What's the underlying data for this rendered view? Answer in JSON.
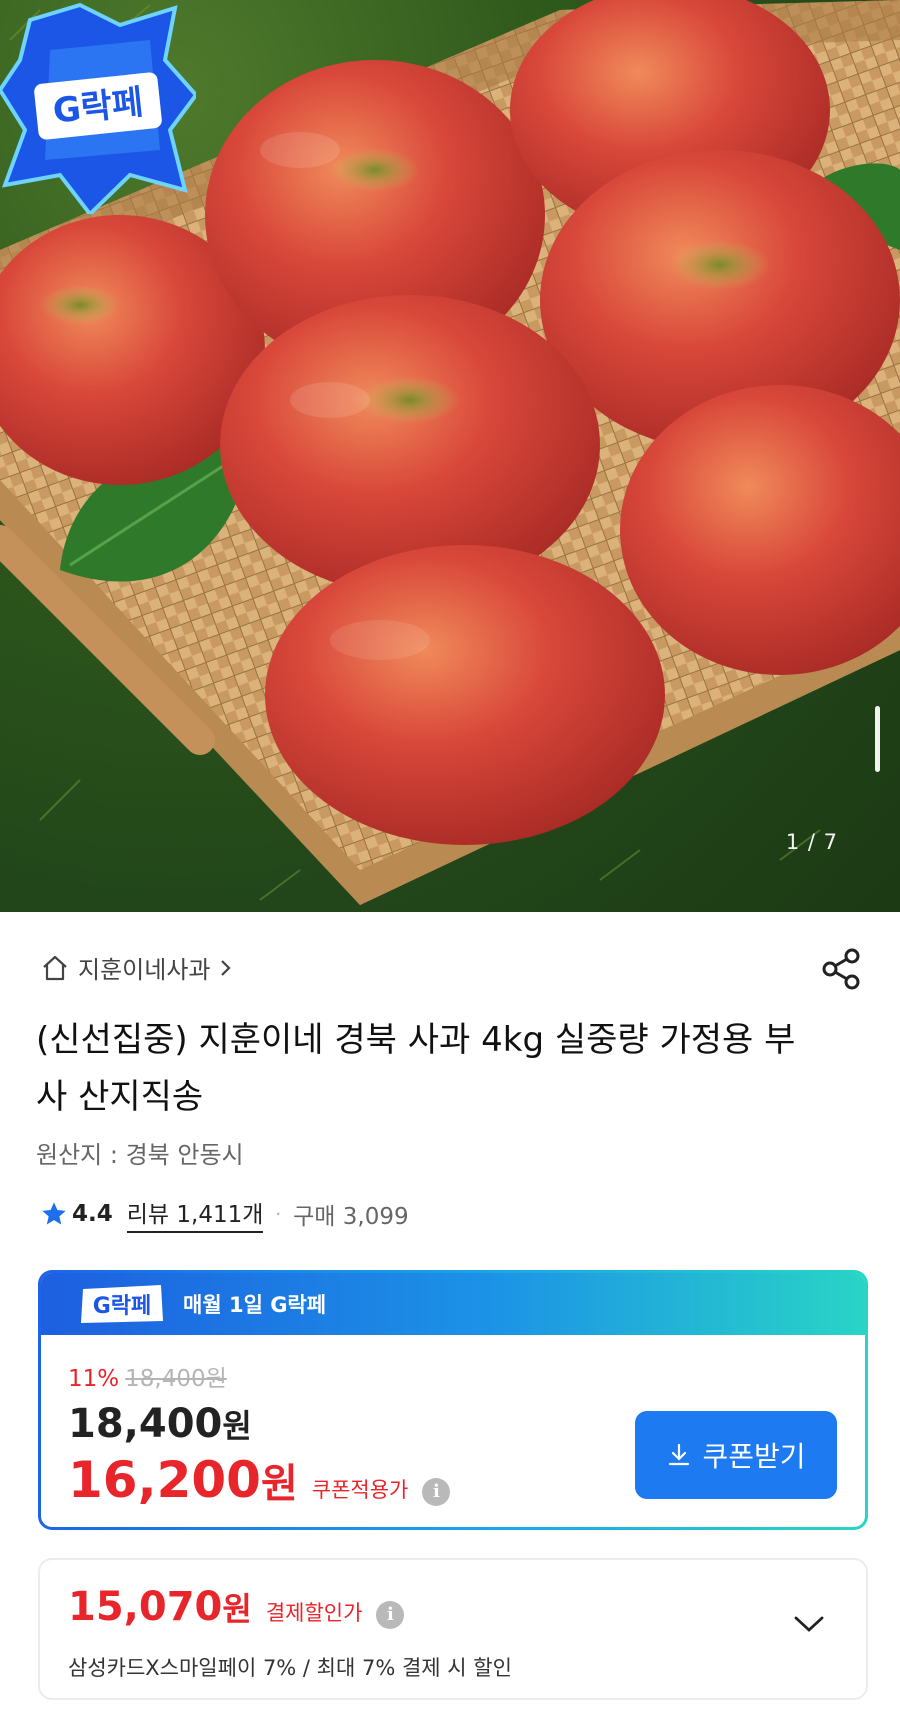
{
  "hero": {
    "image_counter": "1 / 7",
    "badge_logo_text": "G락페"
  },
  "store": {
    "name": "지훈이네사과"
  },
  "product": {
    "title": "(신선집중) 지훈이네 경북 사과 4kg 실중량 가정용 부사 산지직송",
    "origin": "원산지 : 경북 안동시",
    "rating": "4.4",
    "reviews": "리뷰 1,411개",
    "sales": "구매 3,099"
  },
  "promo": {
    "logo_text": "G락페",
    "title": "매월 1일 G락페",
    "discount_rate": "11%",
    "original_price": "18,400원",
    "price_amount": "18,400",
    "price_unit": "원",
    "coupon_amount": "16,200",
    "coupon_unit": "원",
    "coupon_label": "쿠폰적용가",
    "coupon_button": "쿠폰받기"
  },
  "payment": {
    "amount": "15,070",
    "unit": "원",
    "label": "결제할인가",
    "description": "삼성카드X스마일페이 7% / 최대 7% 결제 시 할인"
  },
  "colors": {
    "accent_red": "#e8252b",
    "button_blue": "#1d7af0",
    "gradient_start": "#1d5fe0",
    "gradient_end": "#29d4c6"
  },
  "icons": [
    "home-icon",
    "chevron-right-icon",
    "share-icon",
    "star-icon",
    "info-icon",
    "download-icon",
    "chevron-down-icon"
  ]
}
